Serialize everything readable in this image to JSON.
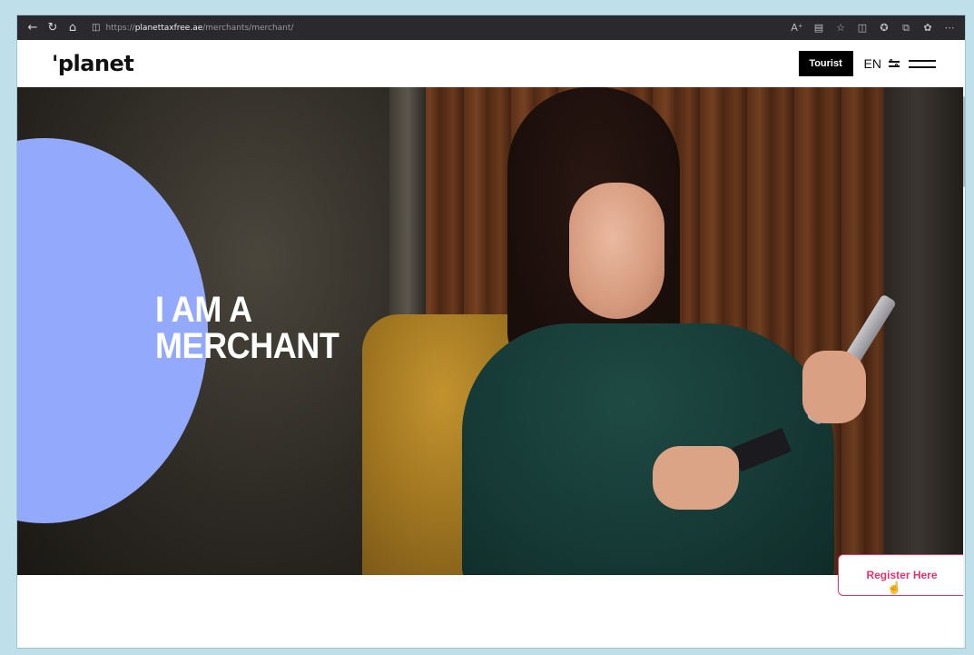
{
  "browser": {
    "url_scheme": "https://",
    "url_host": "planettaxfree.ae",
    "url_path": "/merchants/merchant/",
    "icons": [
      "back-arrow-icon",
      "reload-icon",
      "home-icon",
      "lock-icon",
      "read-aloud-icon",
      "reader-view-icon",
      "favorite-star-icon",
      "split-screen-icon",
      "favorites-icon",
      "collections-icon",
      "extensions-icon",
      "more-icon"
    ]
  },
  "header": {
    "logo": "'planet",
    "tourist_label": "Tourist",
    "language": "EN",
    "icons": [
      "filter-icon",
      "menu-icon"
    ]
  },
  "hero": {
    "title_line1": "I AM A",
    "title_line2": "MERCHANT",
    "circle_color": "#93a9fb"
  },
  "register": {
    "label": "Register Here",
    "accent_color": "#e2336e"
  }
}
